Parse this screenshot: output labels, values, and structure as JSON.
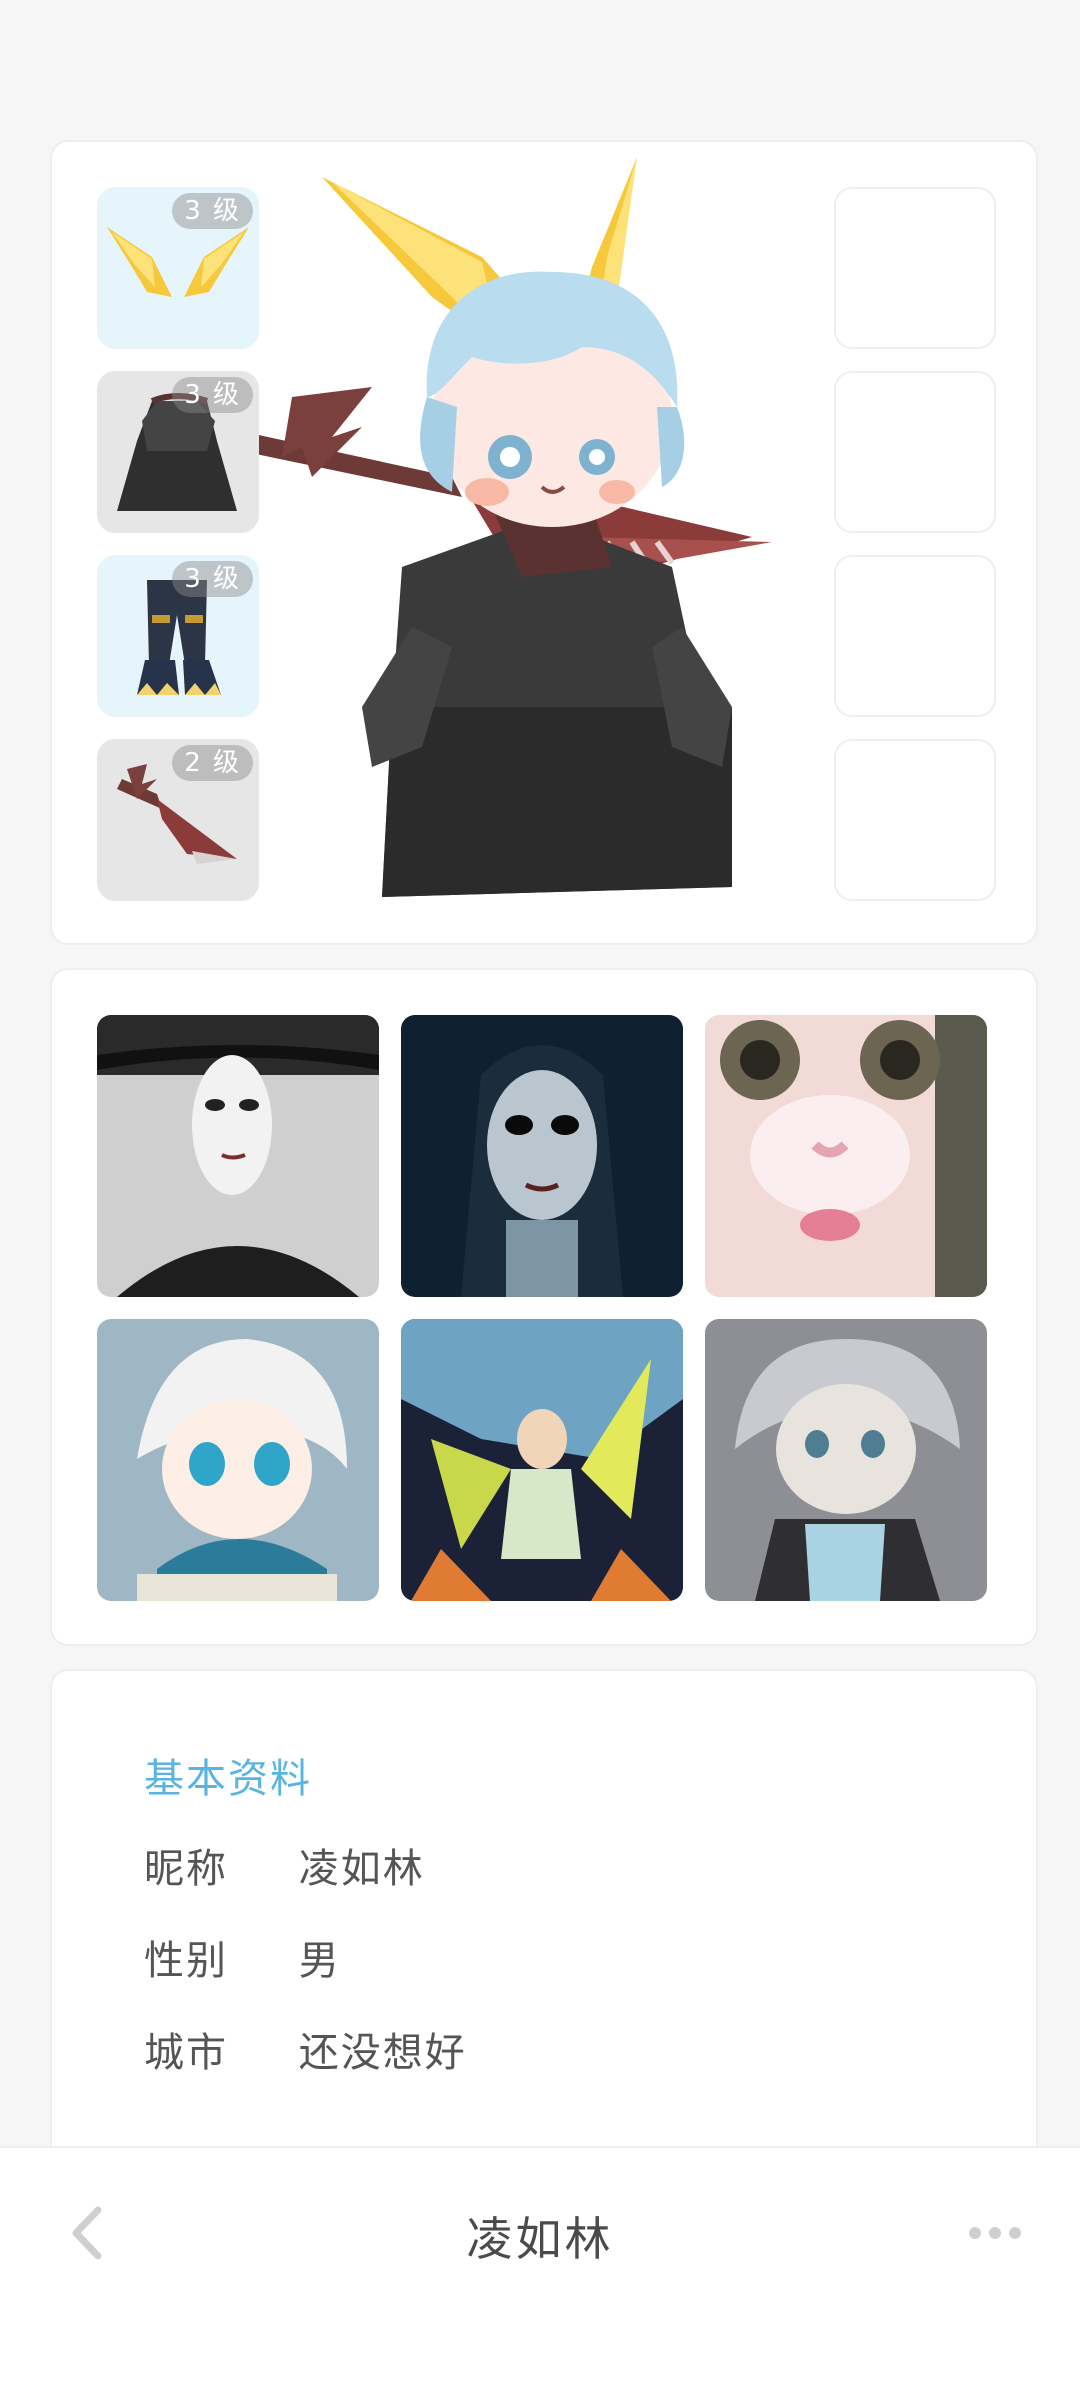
{
  "equipment": {
    "items": [
      {
        "level": "3 级",
        "icon": "horns-icon"
      },
      {
        "level": "3 级",
        "icon": "cloak-icon"
      },
      {
        "level": "3 级",
        "icon": "pants-icon"
      },
      {
        "level": "2 级",
        "icon": "sword-icon"
      }
    ]
  },
  "info": {
    "title": "基本资料",
    "nickname_label": "昵称",
    "nickname_value": "凌如林",
    "gender_label": "性别",
    "gender_value": "男",
    "city_label": "城市",
    "city_value": "还没想好"
  },
  "bottom_bar": {
    "title": "凌如林"
  },
  "colors": {
    "accent": "#5ab4e0",
    "slot_blue": "#e6f4fc",
    "slot_gray": "#e6e6e6"
  }
}
